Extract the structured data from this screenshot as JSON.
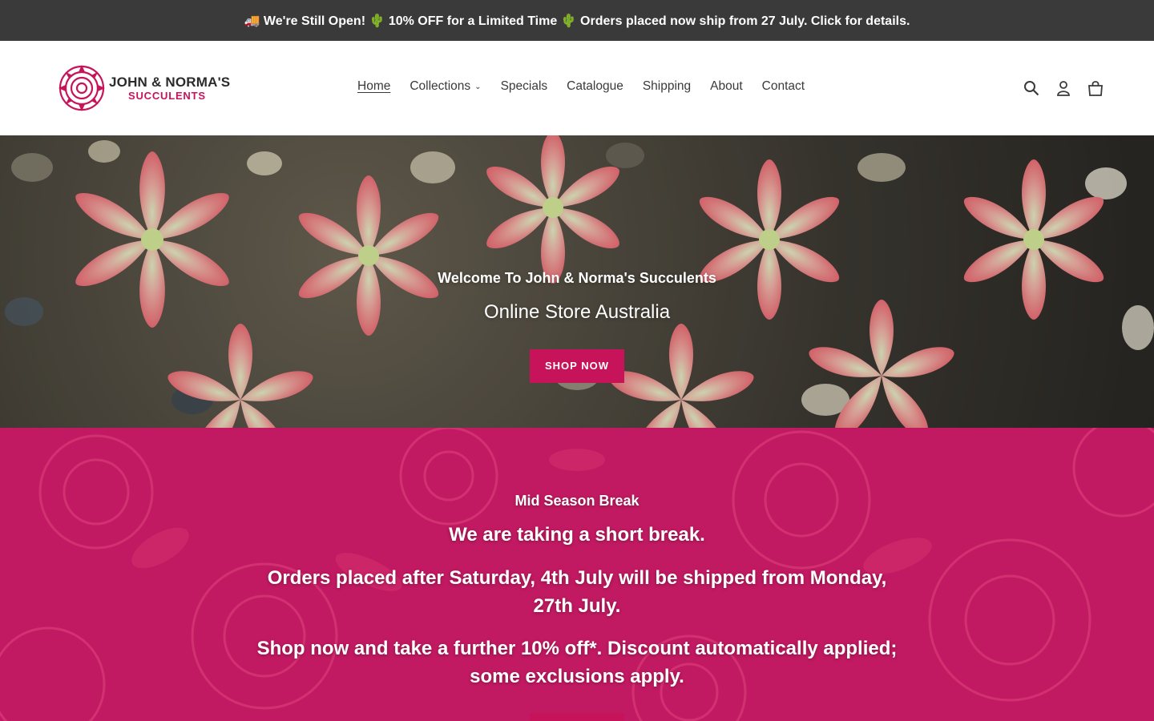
{
  "announcement": {
    "text": "🚚 We're Still Open! 🌵 10% OFF for a Limited Time 🌵 Orders placed now ship from 27 July. Click for details."
  },
  "brand": {
    "line1": "JOHN & NORMA'S",
    "line2": "SUCCULENTS",
    "accent_color": "#c7135a"
  },
  "nav": {
    "items": [
      {
        "label": "Home",
        "active": true
      },
      {
        "label": "Collections",
        "dropdown": true
      },
      {
        "label": "Specials"
      },
      {
        "label": "Catalogue"
      },
      {
        "label": "Shipping"
      },
      {
        "label": "About"
      },
      {
        "label": "Contact"
      }
    ]
  },
  "header_icons": [
    "search-icon",
    "account-icon",
    "cart-icon"
  ],
  "hero": {
    "subtitle": "Welcome To John & Norma's Succulents",
    "title": "Online Store Australia",
    "button_label": "SHOP NOW"
  },
  "promo": {
    "kicker": "Mid Season Break",
    "heading": "We are taking a short break.",
    "paragraph1": "Orders placed after Saturday, 4th July will be shipped from Monday, 27th July.",
    "paragraph2": "Shop now and take a further 10% off*. Discount automatically applied; some exclusions apply.",
    "background_color": "#c21a62"
  }
}
